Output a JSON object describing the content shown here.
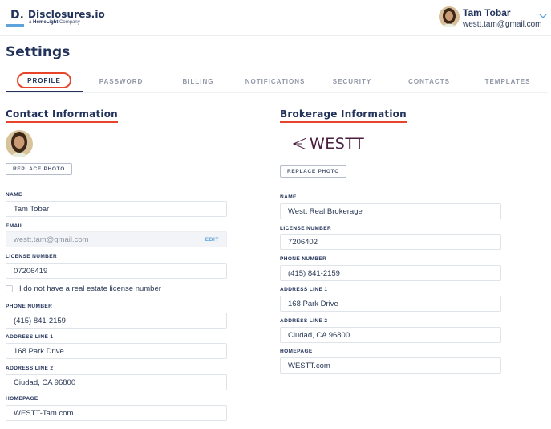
{
  "header": {
    "logo_letter": "D.",
    "brand_name": "Disclosures.io",
    "brand_sub_prefix": "a",
    "brand_sub_company": "HomeLight",
    "brand_sub_suffix": "Company",
    "user": {
      "name": "Tam Tobar",
      "email": "westt.tam@gmail.com"
    }
  },
  "page": {
    "title": "Settings"
  },
  "tabs": [
    {
      "label": "PROFILE",
      "active": true
    },
    {
      "label": "PASSWORD",
      "active": false
    },
    {
      "label": "BILLING",
      "active": false
    },
    {
      "label": "NOTIFICATIONS",
      "active": false
    },
    {
      "label": "SECURITY",
      "active": false
    },
    {
      "label": "CONTACTS",
      "active": false
    },
    {
      "label": "TEMPLATES",
      "active": false
    }
  ],
  "contact": {
    "title": "Contact Information",
    "replace_photo": "REPLACE PHOTO",
    "fields": {
      "name": {
        "label": "NAME",
        "value": "Tam Tobar"
      },
      "email": {
        "label": "EMAIL",
        "value": "westt.tam@gmail.com",
        "action": "EDIT"
      },
      "license": {
        "label": "LICENSE NUMBER",
        "value": "07206419"
      },
      "phone": {
        "label": "PHONE NUMBER",
        "value": "(415) 841-2159"
      },
      "address1": {
        "label": "ADDRESS LINE 1",
        "value": "168 Park Drive."
      },
      "address2": {
        "label": "ADDRESS LINE 2",
        "value": "Ciudad, CA 96800"
      },
      "homepage": {
        "label": "HOMEPAGE",
        "value": "WESTT-Tam.com"
      }
    },
    "no_license_checkbox": {
      "label": "I do not have a real estate license number",
      "checked": false
    }
  },
  "brokerage": {
    "title": "Brokerage Information",
    "logo_text": "WESTT",
    "replace_photo": "REPLACE PHOTO",
    "fields": {
      "name": {
        "label": "NAME",
        "value": "Westt Real Brokerage"
      },
      "license": {
        "label": "LICENSE NUMBER",
        "value": "7206402"
      },
      "phone": {
        "label": "PHONE NUMBER",
        "value": "(415) 841-2159"
      },
      "address1": {
        "label": "ADDRESS LINE 1",
        "value": "168 Park Drive"
      },
      "address2": {
        "label": "ADDRESS LINE 2",
        "value": "Ciudad, CA 96800"
      },
      "homepage": {
        "label": "HOMEPAGE",
        "value": "WESTT.com"
      }
    }
  },
  "colors": {
    "primary_navy": "#22325a",
    "accent_red": "#e6452c",
    "link_blue": "#5ea3dc",
    "brokerage_brand": "#4a1e3e"
  }
}
